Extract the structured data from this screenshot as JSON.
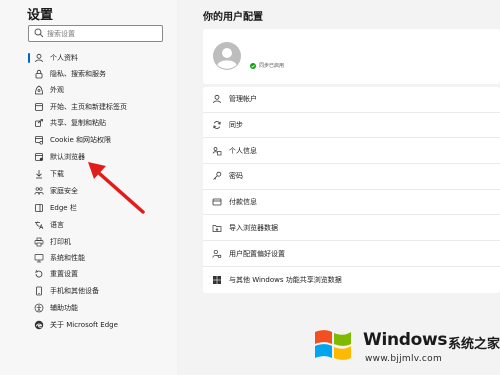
{
  "sidebar": {
    "title": "设置",
    "search_placeholder": "搜索设置",
    "items": [
      {
        "label": "个人资料",
        "icon": "person-icon",
        "active": true
      },
      {
        "label": "隐私、搜索和服务",
        "icon": "lock-icon"
      },
      {
        "label": "外观",
        "icon": "appearance-icon"
      },
      {
        "label": "开始、主页和新建标签页",
        "icon": "power-icon"
      },
      {
        "label": "共享、复制和粘贴",
        "icon": "share-icon"
      },
      {
        "label": "Cookie 和网站权限",
        "icon": "cookie-icon"
      },
      {
        "label": "默认浏览器",
        "icon": "browser-icon"
      },
      {
        "label": "下载",
        "icon": "download-icon"
      },
      {
        "label": "家庭安全",
        "icon": "family-icon"
      },
      {
        "label": "Edge 栏",
        "icon": "edge-bar-icon"
      },
      {
        "label": "语言",
        "icon": "language-icon"
      },
      {
        "label": "打印机",
        "icon": "printer-icon"
      },
      {
        "label": "系统和性能",
        "icon": "system-icon"
      },
      {
        "label": "重置设置",
        "icon": "reset-icon"
      },
      {
        "label": "手机和其他设备",
        "icon": "phone-icon"
      },
      {
        "label": "辅助功能",
        "icon": "accessibility-icon"
      },
      {
        "label": "关于 Microsoft Edge",
        "icon": "edge-logo-icon"
      }
    ]
  },
  "main": {
    "title": "你的用户配置",
    "profile": {
      "sync_status": "同步已启用",
      "status_color": "#13a10e"
    },
    "rows": [
      {
        "label": "管理帐户",
        "icon": "person-icon"
      },
      {
        "label": "同步",
        "icon": "sync-icon"
      },
      {
        "label": "个人信息",
        "icon": "id-card-icon"
      },
      {
        "label": "密码",
        "icon": "key-icon"
      },
      {
        "label": "付款信息",
        "icon": "credit-card-icon"
      },
      {
        "label": "导入浏览器数据",
        "icon": "import-icon"
      },
      {
        "label": "用户配置偏好设置",
        "icon": "profile-settings-icon"
      },
      {
        "label": "与其他 Windows 功能共享浏览数据",
        "icon": "windows-icon"
      }
    ]
  },
  "watermark": {
    "brand": "Windows",
    "cn": "系统之家",
    "url": "www.bjjmlv.com"
  },
  "colors": {
    "accent": "#0067c0",
    "annotation_arrow": "#e21b1b"
  }
}
